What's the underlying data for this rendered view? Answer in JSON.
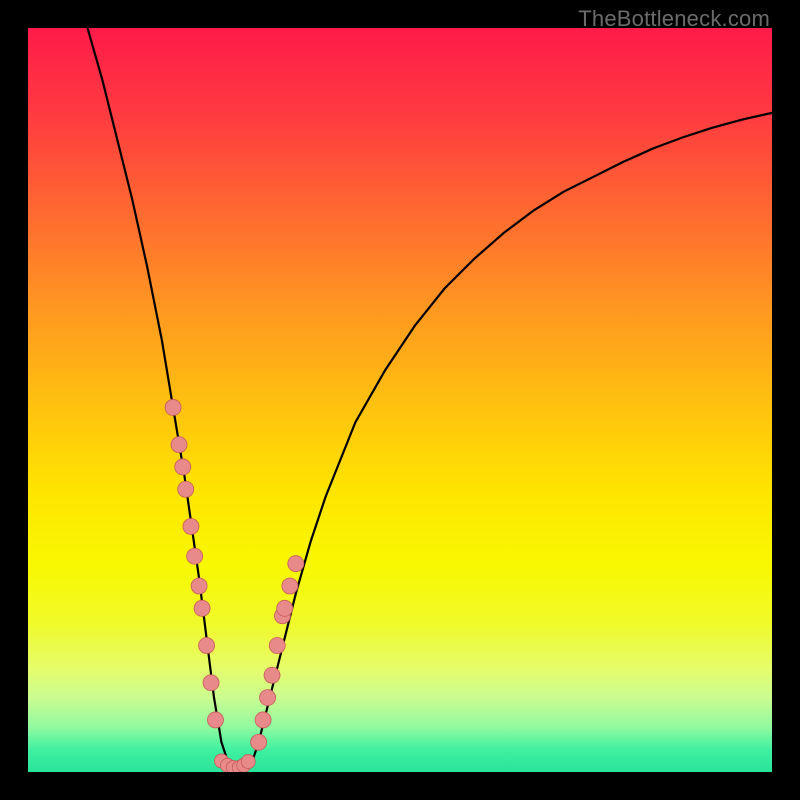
{
  "watermark": "TheBottleneck.com",
  "chart_data": {
    "type": "line",
    "title": "",
    "xlabel": "",
    "ylabel": "",
    "xlim": [
      0,
      100
    ],
    "ylim": [
      0,
      100
    ],
    "curve": {
      "x": [
        8,
        10,
        12,
        14,
        16,
        18,
        20,
        21,
        22,
        23,
        24,
        25,
        26,
        27,
        28,
        29,
        30,
        31,
        32,
        34,
        36,
        38,
        40,
        44,
        48,
        52,
        56,
        60,
        64,
        68,
        72,
        76,
        80,
        84,
        88,
        92,
        96,
        100
      ],
      "y": [
        100,
        93,
        85,
        77,
        68,
        58,
        46,
        40,
        33,
        26,
        18,
        10,
        4,
        1,
        0.2,
        0.2,
        1,
        4,
        8,
        16,
        24,
        31,
        37,
        47,
        54,
        60,
        65,
        69,
        72.5,
        75.5,
        78,
        80,
        82,
        83.8,
        85.3,
        86.6,
        87.7,
        88.6
      ]
    },
    "scatter_left": {
      "x": [
        19.5,
        20.3,
        20.8,
        21.2,
        21.9,
        22.4,
        23.0,
        23.4,
        24.0,
        24.6,
        25.2
      ],
      "y": [
        49,
        44,
        41,
        38,
        33,
        29,
        25,
        22,
        17,
        12,
        7
      ]
    },
    "scatter_right": {
      "x": [
        31.0,
        31.6,
        32.2,
        32.8,
        33.5,
        34.2,
        34.5,
        35.2,
        36.0
      ],
      "y": [
        4,
        7,
        10,
        13,
        17,
        21,
        22,
        25,
        28
      ]
    },
    "scatter_bottom": {
      "x": [
        26.0,
        26.8,
        27.6,
        28.4,
        29.0,
        29.6
      ],
      "y": [
        1.5,
        0.9,
        0.6,
        0.6,
        0.9,
        1.4
      ]
    },
    "colors": {
      "curve": "#000000",
      "dot_fill": "#e88a8a",
      "dot_stroke": "#c85a5a"
    }
  }
}
